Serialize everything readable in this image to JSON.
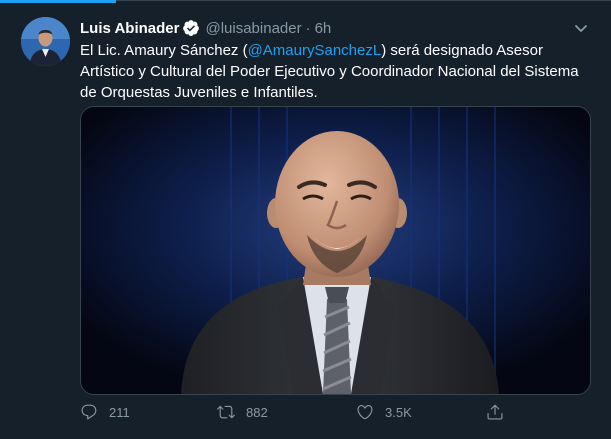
{
  "tweet": {
    "author_name": "Luis Abinader",
    "handle": "@luisabinader",
    "separator": "·",
    "time": "6h",
    "text_before": "El Lic. Amaury Sánchez (",
    "mention": "@AmaurySanchezL",
    "text_after": ") será designado Asesor Artístico y Cultural del Poder Ejecutivo y Coordinador Nacional del Sistema de Orquestas Juveniles e Infantiles."
  },
  "actions": {
    "reply_count": "211",
    "retweet_count": "882",
    "like_count": "3.5K"
  },
  "icons": {
    "verified": "verified-badge-icon",
    "caret": "chevron-down-icon",
    "reply": "reply-icon",
    "retweet": "retweet-icon",
    "like": "heart-icon",
    "share": "share-icon"
  },
  "colors": {
    "background": "#15202b",
    "accent": "#1da1f2",
    "secondary_text": "#8899a6",
    "border": "#38444d"
  }
}
